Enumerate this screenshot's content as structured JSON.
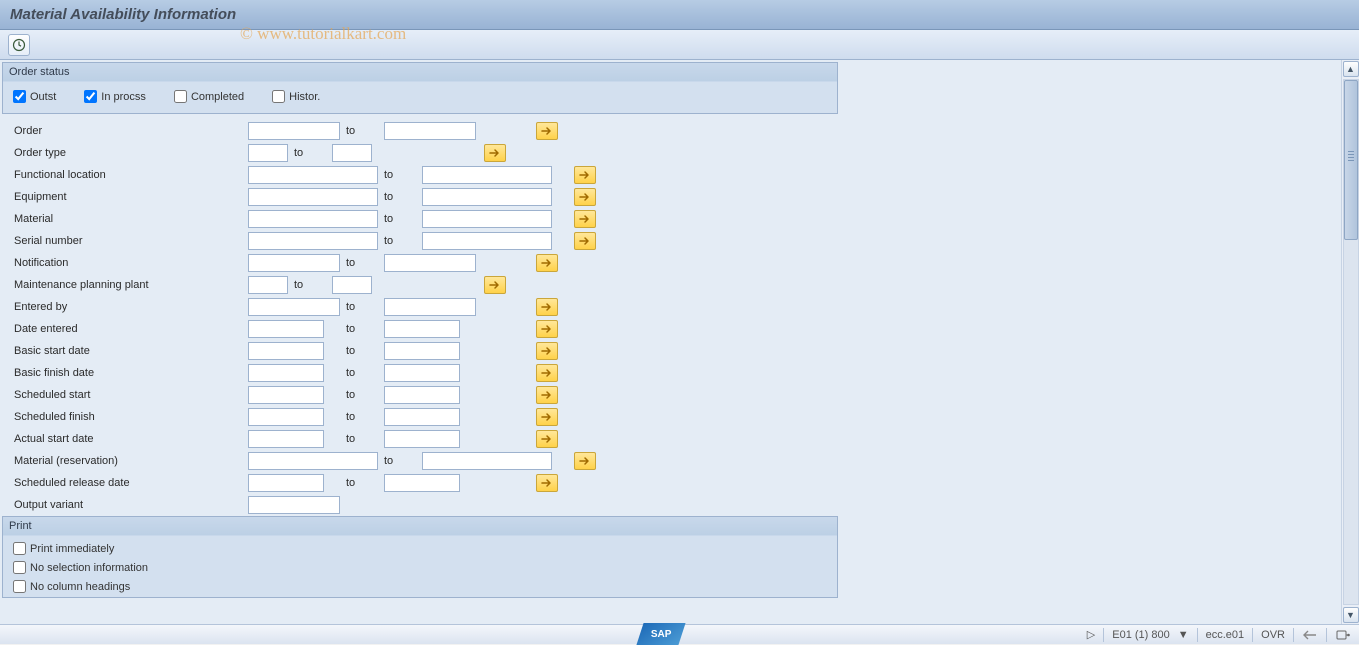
{
  "title": "Material Availability Information",
  "watermark": "© www.tutorialkart.com",
  "order_status": {
    "group_label": "Order status",
    "outst": {
      "label": "Outst",
      "checked": true
    },
    "in_process": {
      "label": "In procss",
      "checked": true
    },
    "completed": {
      "label": "Completed",
      "checked": false
    },
    "histor": {
      "label": "Histor.",
      "checked": false
    }
  },
  "to_label": "to",
  "fields": [
    {
      "key": "order",
      "label": "Order",
      "width": "med",
      "range": true
    },
    {
      "key": "order_type",
      "label": "Order type",
      "width": "short",
      "range": true
    },
    {
      "key": "functional_location",
      "label": "Functional location",
      "width": "full",
      "range": true
    },
    {
      "key": "equipment",
      "label": "Equipment",
      "width": "full",
      "range": true
    },
    {
      "key": "material",
      "label": "Material",
      "width": "full",
      "range": true
    },
    {
      "key": "serial_number",
      "label": "Serial number",
      "width": "full",
      "range": true
    },
    {
      "key": "notification",
      "label": "Notification",
      "width": "med",
      "range": true
    },
    {
      "key": "maint_plant",
      "label": "Maintenance planning plant",
      "width": "short",
      "range": true
    },
    {
      "key": "entered_by",
      "label": "Entered by",
      "width": "med",
      "range": true
    },
    {
      "key": "date_entered",
      "label": "Date entered",
      "width": "date",
      "range": true
    },
    {
      "key": "basic_start",
      "label": "Basic start date",
      "width": "date",
      "range": true
    },
    {
      "key": "basic_finish",
      "label": "Basic finish date",
      "width": "date",
      "range": true
    },
    {
      "key": "sched_start",
      "label": "Scheduled start",
      "width": "date",
      "range": true
    },
    {
      "key": "sched_finish",
      "label": "Scheduled finish",
      "width": "date",
      "range": true
    },
    {
      "key": "actual_start",
      "label": "Actual start date",
      "width": "date",
      "range": true
    },
    {
      "key": "material_res",
      "label": "Material (reservation)",
      "width": "full",
      "range": true
    },
    {
      "key": "sched_release",
      "label": "Scheduled release date",
      "width": "date",
      "range": true
    },
    {
      "key": "output_variant",
      "label": "Output variant",
      "width": "med",
      "range": false
    }
  ],
  "print": {
    "group_label": "Print",
    "immediately": {
      "label": "Print immediately",
      "checked": false
    },
    "no_selection": {
      "label": "No selection information",
      "checked": false
    },
    "no_headings": {
      "label": "No column headings",
      "checked": false
    }
  },
  "statusbar": {
    "sap": "SAP",
    "triangle": "▷",
    "system": "E01 (1) 800",
    "dropdown": "▼",
    "server": "ecc.e01",
    "mode": "OVR"
  }
}
